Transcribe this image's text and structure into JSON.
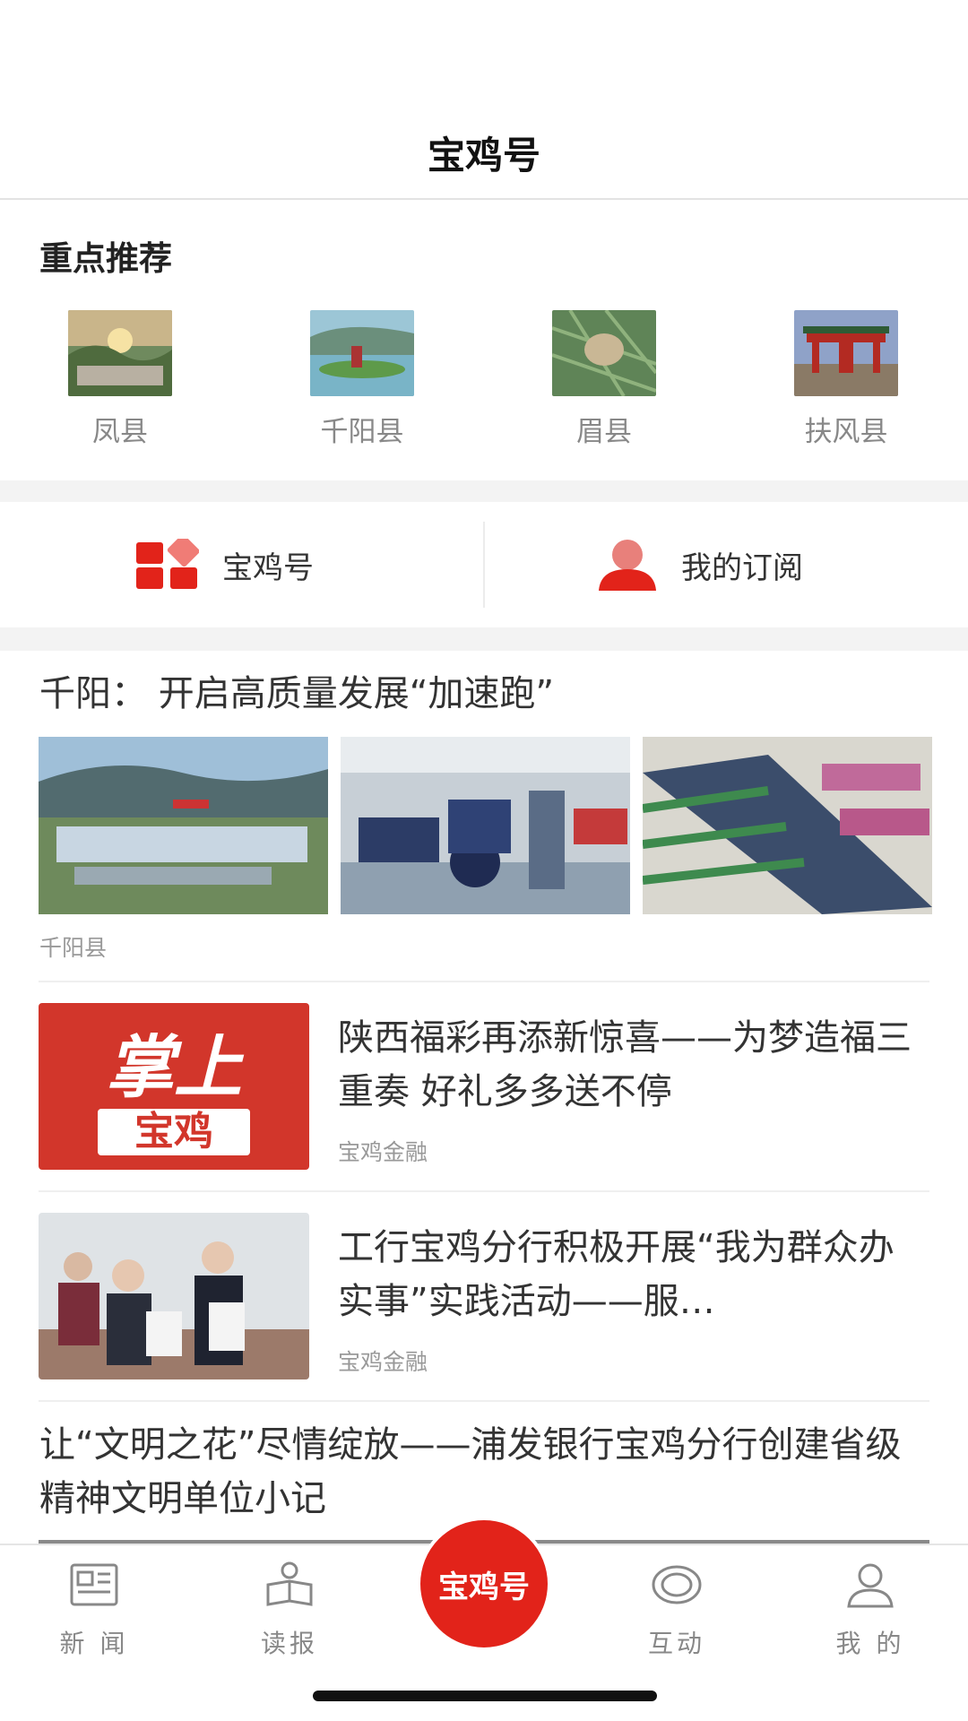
{
  "header": {
    "title": "宝鸡号"
  },
  "recommend": {
    "title": "重点推荐",
    "items": [
      {
        "label": "凤县"
      },
      {
        "label": "千阳县"
      },
      {
        "label": "眉县"
      },
      {
        "label": "扶风县"
      }
    ]
  },
  "switch": {
    "left_label": "宝鸡号",
    "right_label": "我的订阅"
  },
  "feed": {
    "item1": {
      "title": "千阳：  开启高质量发展“加速跑”",
      "source": "千阳县"
    },
    "item2": {
      "title": "陕西福彩再添新惊喜——为梦造福三重奏  好礼多多送不停",
      "source": "宝鸡金融",
      "logo_text_top": "掌上",
      "logo_text_bottom": "宝鸡"
    },
    "item3": {
      "title": "工行宝鸡分行积极开展“我为群众办实事”实践活动——服…",
      "source": "宝鸡金融"
    },
    "item4": {
      "title": "让“文明之花”尽情绽放——浦发银行宝鸡分行创建省级精神文明单位小记"
    }
  },
  "tabbar": {
    "items": [
      {
        "label": "新 闻",
        "icon": "newspaper-icon"
      },
      {
        "label": "读报",
        "icon": "reader-icon"
      },
      {
        "label": "宝鸡号",
        "icon": "center-button"
      },
      {
        "label": "互动",
        "icon": "interact-icon"
      },
      {
        "label": "我 的",
        "icon": "profile-icon"
      }
    ]
  },
  "colors": {
    "accent": "#e2231a",
    "text": "#333333",
    "muted": "#999999"
  }
}
